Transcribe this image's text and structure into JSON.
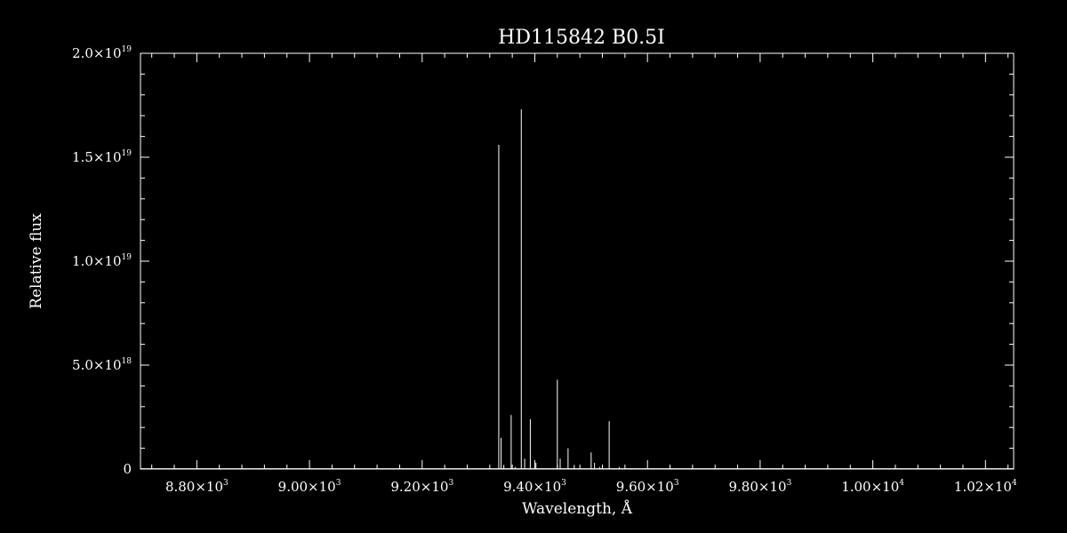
{
  "chart_data": {
    "type": "line",
    "title": "HD115842   B0.5I",
    "xlabel": "Wavelength, Å",
    "ylabel": "Relative flux",
    "xlim": [
      8700,
      10250
    ],
    "ylim": [
      0,
      2e+19
    ],
    "x_ticks": [
      {
        "value": 8800,
        "mantissa": "8.80×10",
        "exp": "3"
      },
      {
        "value": 9000,
        "mantissa": "9.00×10",
        "exp": "3"
      },
      {
        "value": 9200,
        "mantissa": "9.20×10",
        "exp": "3"
      },
      {
        "value": 9400,
        "mantissa": "9.40×10",
        "exp": "3"
      },
      {
        "value": 9600,
        "mantissa": "9.60×10",
        "exp": "3"
      },
      {
        "value": 9800,
        "mantissa": "9.80×10",
        "exp": "3"
      },
      {
        "value": 10000,
        "mantissa": "1.00×10",
        "exp": "4"
      },
      {
        "value": 10200,
        "mantissa": "1.02×10",
        "exp": "4"
      }
    ],
    "y_ticks": [
      {
        "value": 0,
        "mantissa": "0",
        "exp": ""
      },
      {
        "value": 5e+18,
        "mantissa": "5.0×10",
        "exp": "18"
      },
      {
        "value": 1e+19,
        "mantissa": "1.0×10",
        "exp": "19"
      },
      {
        "value": 1.5e+19,
        "mantissa": "1.5×10",
        "exp": "19"
      },
      {
        "value": 2e+19,
        "mantissa": "2.0×10",
        "exp": "19"
      }
    ],
    "series": [
      {
        "color": "#ffffff",
        "spikes": [
          {
            "x": 9336,
            "y": 1.56e+19
          },
          {
            "x": 9340,
            "y": 1.5e+18
          },
          {
            "x": 9345,
            "y": 2e+17
          },
          {
            "x": 9358,
            "y": 2.6e+18
          },
          {
            "x": 9365,
            "y": 1e+17
          },
          {
            "x": 9376,
            "y": 1.73e+19
          },
          {
            "x": 9382,
            "y": 5e+17
          },
          {
            "x": 9392,
            "y": 2.4e+18
          },
          {
            "x": 9402,
            "y": 3e+17
          },
          {
            "x": 9440,
            "y": 4.3e+18
          },
          {
            "x": 9445,
            "y": 5e+17
          },
          {
            "x": 9459,
            "y": 1e+18
          },
          {
            "x": 9470,
            "y": 2e+17
          },
          {
            "x": 9500,
            "y": 8e+17
          },
          {
            "x": 9506,
            "y": 3e+17
          },
          {
            "x": 9515,
            "y": 1e+17
          },
          {
            "x": 9532,
            "y": 2.3e+18
          },
          {
            "x": 9550,
            "y": 1e+17
          }
        ]
      }
    ]
  }
}
